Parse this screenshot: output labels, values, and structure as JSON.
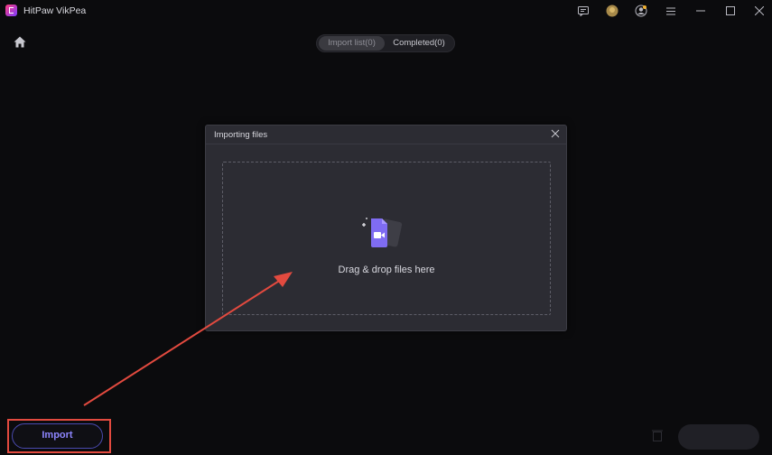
{
  "app": {
    "title": "HitPaw VikPea"
  },
  "tabs": [
    {
      "label": "Import list(0)"
    },
    {
      "label": "Completed(0)"
    }
  ],
  "dialog": {
    "title": "Importing files",
    "drop_text": "Drag & drop files here"
  },
  "footer": {
    "import_label": "Import"
  },
  "icons": {
    "logo": "app-logo-icon",
    "feedback": "chat-icon",
    "account": "avatar-icon",
    "profile": "user-icon",
    "menu": "hamburger-icon",
    "minimize": "minimize-icon",
    "maximize": "maximize-icon",
    "close": "close-icon",
    "home": "home-icon",
    "file": "video-file-icon",
    "trash": "trash-icon"
  },
  "colors": {
    "accent": "#8e86ff",
    "highlight": "#e24a3f",
    "file_icon": "#7f6cf2"
  }
}
